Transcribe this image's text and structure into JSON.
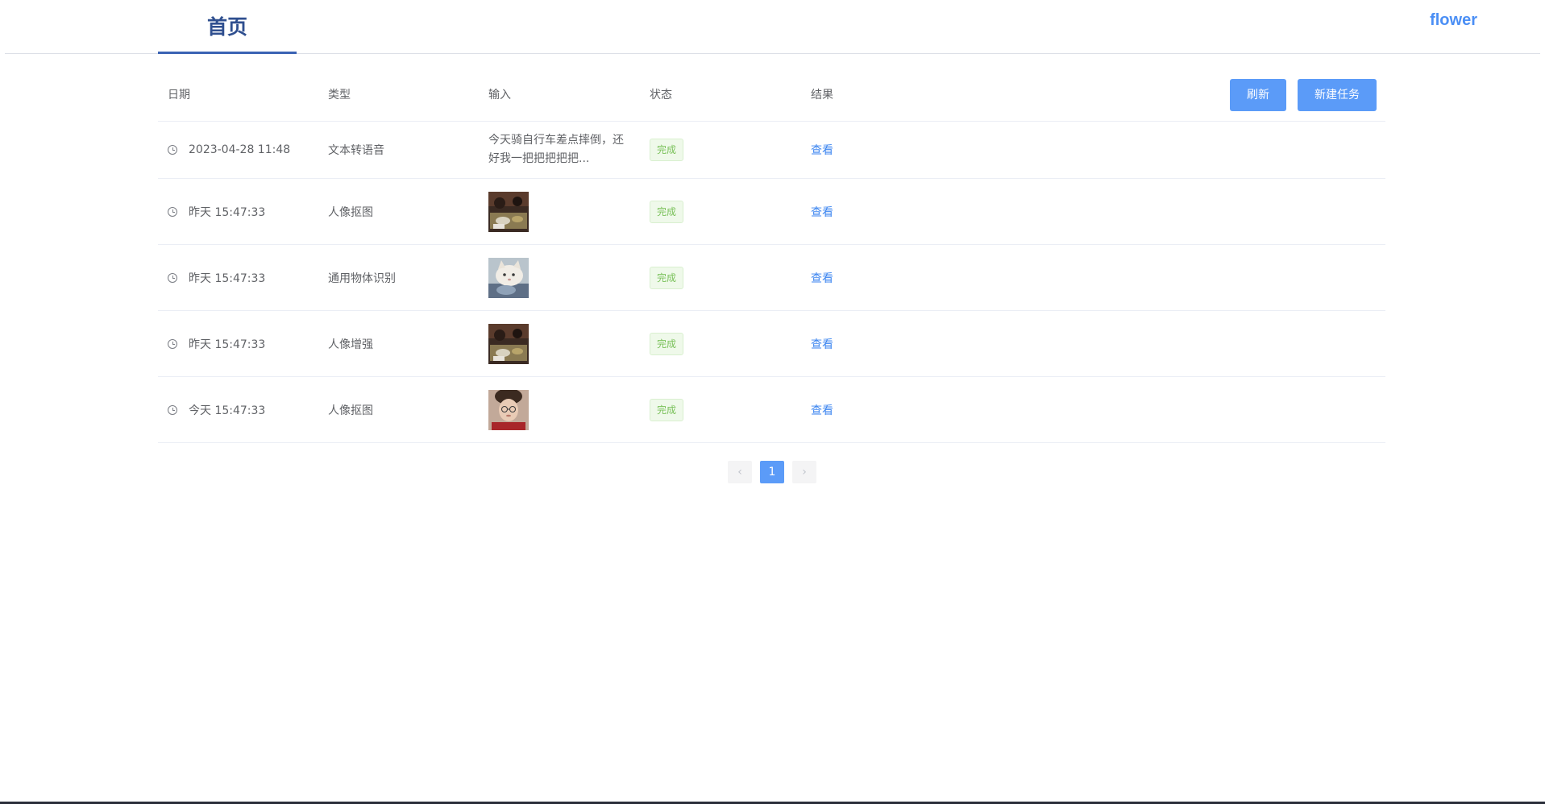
{
  "nav": {
    "tab_home": "首页",
    "brand": "flower"
  },
  "table": {
    "headers": {
      "date": "日期",
      "type": "类型",
      "input": "输入",
      "status": "状态",
      "result": "结果"
    },
    "buttons": {
      "refresh": "刷新",
      "new_task": "新建任务"
    },
    "rows": [
      {
        "date": "2023-04-28 11:48",
        "type": "文本转语音",
        "input": "今天骑自行车差点摔倒，还好我一把把把把把...",
        "input_kind": "text",
        "status": "完成",
        "result": "查看"
      },
      {
        "date": "昨天 15:47:33",
        "type": "人像抠图",
        "input_kind": "image",
        "input_image": "dinner-table-photo",
        "status": "完成",
        "result": "查看"
      },
      {
        "date": "昨天 15:47:33",
        "type": "通用物体识别",
        "input_kind": "image",
        "input_image": "white-cat-photo",
        "status": "完成",
        "result": "查看"
      },
      {
        "date": "昨天 15:47:33",
        "type": "人像增强",
        "input_kind": "image",
        "input_image": "dinner-table-photo",
        "status": "完成",
        "result": "查看"
      },
      {
        "date": "今天 15:47:33",
        "type": "人像抠图",
        "input_kind": "image",
        "input_image": "portrait-photo",
        "status": "完成",
        "result": "查看"
      }
    ]
  },
  "pagination": {
    "prev": "‹",
    "current": "1",
    "next": "›"
  },
  "colors": {
    "primary": "#5b9bf8",
    "link": "#3d86f0",
    "success_bg": "#eff9ea",
    "success_text": "#7ac15a",
    "nav_active": "#2f4f8f"
  }
}
